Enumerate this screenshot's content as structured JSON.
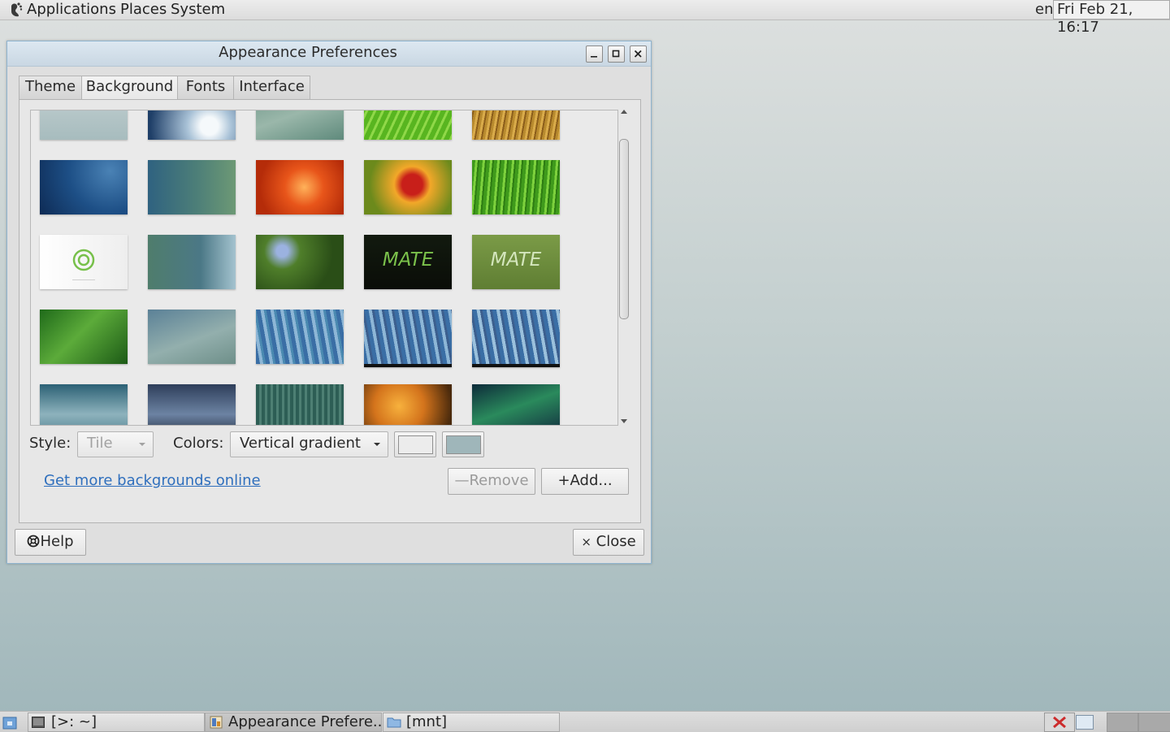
{
  "top_panel": {
    "menus": [
      "Applications",
      "Places",
      "System"
    ],
    "keyboard_layout": "en",
    "clock": "Fri Feb 21, 16:17"
  },
  "window": {
    "title": "Appearance Preferences",
    "controls": {
      "minimize": "_",
      "maximize": "□",
      "close": "×"
    },
    "tabs": [
      "Theme",
      "Background",
      "Fonts",
      "Interface"
    ],
    "active_tab": "Background"
  },
  "background_tab": {
    "style_label": "Style:",
    "style_value": "Tile",
    "colors_label": "Colors:",
    "colors_value": "Vertical gradient",
    "primary_color": "#ececec",
    "secondary_color": "#9fb6ba",
    "link_text": "Get more backgrounds online",
    "remove_label": "Remove",
    "add_label": "Add..."
  },
  "wallpapers": [
    {
      "name": "gradient-selected",
      "selected": true
    },
    {
      "name": "water-drop"
    },
    {
      "name": "teal-waves"
    },
    {
      "name": "green-leaf-macro"
    },
    {
      "name": "golden-grass"
    },
    {
      "name": "blue-bubbles"
    },
    {
      "name": "teal-dots"
    },
    {
      "name": "orange-flower"
    },
    {
      "name": "red-flower"
    },
    {
      "name": "green-grass"
    },
    {
      "name": "mate-logo-white"
    },
    {
      "name": "teal-curves"
    },
    {
      "name": "forget-me-nots"
    },
    {
      "name": "mate-dark",
      "text": "MATE"
    },
    {
      "name": "mate-green",
      "text": "MATE"
    },
    {
      "name": "green-leaves"
    },
    {
      "name": "grey-teal-waves"
    },
    {
      "name": "blue-fractal-1"
    },
    {
      "name": "blue-fractal-2"
    },
    {
      "name": "blue-fractal-3"
    },
    {
      "name": "misty-waves"
    },
    {
      "name": "stormy-sky"
    },
    {
      "name": "green-stripes"
    },
    {
      "name": "dandelion-orange"
    },
    {
      "name": "aurora"
    }
  ],
  "footer": {
    "help_label": "Help",
    "close_label": "Close"
  },
  "taskbar": {
    "tasks": [
      "[>: ~]",
      "Appearance Prefere...",
      "[mnt]"
    ]
  }
}
